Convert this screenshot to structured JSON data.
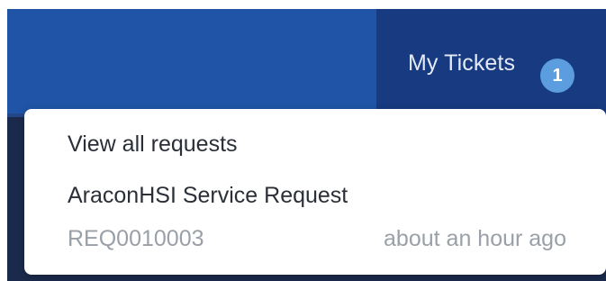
{
  "header": {
    "my_tickets_label": "My Tickets",
    "ticket_count": "1"
  },
  "dropdown": {
    "view_all_label": "View all requests",
    "items": [
      {
        "title": "AraconHSI Service Request",
        "number": "REQ0010003",
        "time": "about an hour ago"
      }
    ]
  },
  "colors": {
    "header_bg": "#1f54a6",
    "my_tickets_bg": "#173a80",
    "badge_bg": "#5b9ddf",
    "secondary_text": "#9aa0a8"
  }
}
